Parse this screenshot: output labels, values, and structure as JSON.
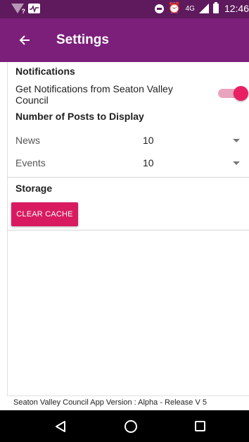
{
  "statusbar": {
    "network_type": "4G",
    "time": "12:46",
    "wifi_badge": "?"
  },
  "toolbar": {
    "title": "Settings",
    "back_icon": "arrow-back-icon"
  },
  "notifications": {
    "section_title": "Notifications",
    "pref_label_line1": "Get Notifications from Seaton Valley",
    "pref_label_line2": "Council",
    "enabled": true
  },
  "posts": {
    "section_title": "Number of Posts to Display",
    "rows": [
      {
        "label": "News",
        "value": "10"
      },
      {
        "label": "Events",
        "value": "10"
      }
    ]
  },
  "storage": {
    "section_title": "Storage",
    "clear_button_label": "CLEAR CACHE"
  },
  "footer": {
    "version_text": "Seaton Valley Council App Version : Alpha - Release V 5"
  },
  "colors": {
    "statusbar": "#5e1a5c",
    "toolbar": "#7b1f7a",
    "accent": "#d81b60",
    "toggle_thumb": "#e91e63",
    "toggle_track": "#e8a5bd"
  }
}
